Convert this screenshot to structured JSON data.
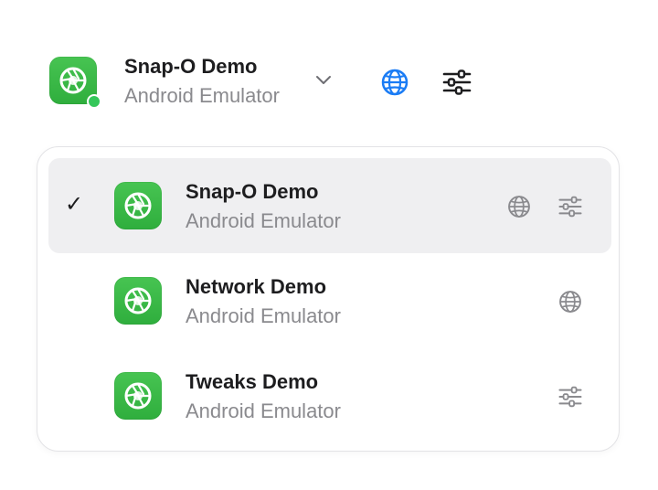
{
  "header": {
    "title": "Snap-O Demo",
    "subtitle": "Android Emulator",
    "icons": [
      "app-shutter-icon",
      "chevron-down-icon",
      "globe-icon",
      "sliders-icon"
    ],
    "globe_color": "#1a7cf5",
    "status_color": "#34c759"
  },
  "dropdown": {
    "items": [
      {
        "title": "Snap-O Demo",
        "subtitle": "Android Emulator",
        "selected": true,
        "check": "✓",
        "has_network": true,
        "has_tweaks": true
      },
      {
        "title": "Network Demo",
        "subtitle": "Android Emulator",
        "selected": false,
        "has_network": true,
        "has_tweaks": false
      },
      {
        "title": "Tweaks Demo",
        "subtitle": "Android Emulator",
        "selected": false,
        "has_network": false,
        "has_tweaks": true
      }
    ]
  }
}
